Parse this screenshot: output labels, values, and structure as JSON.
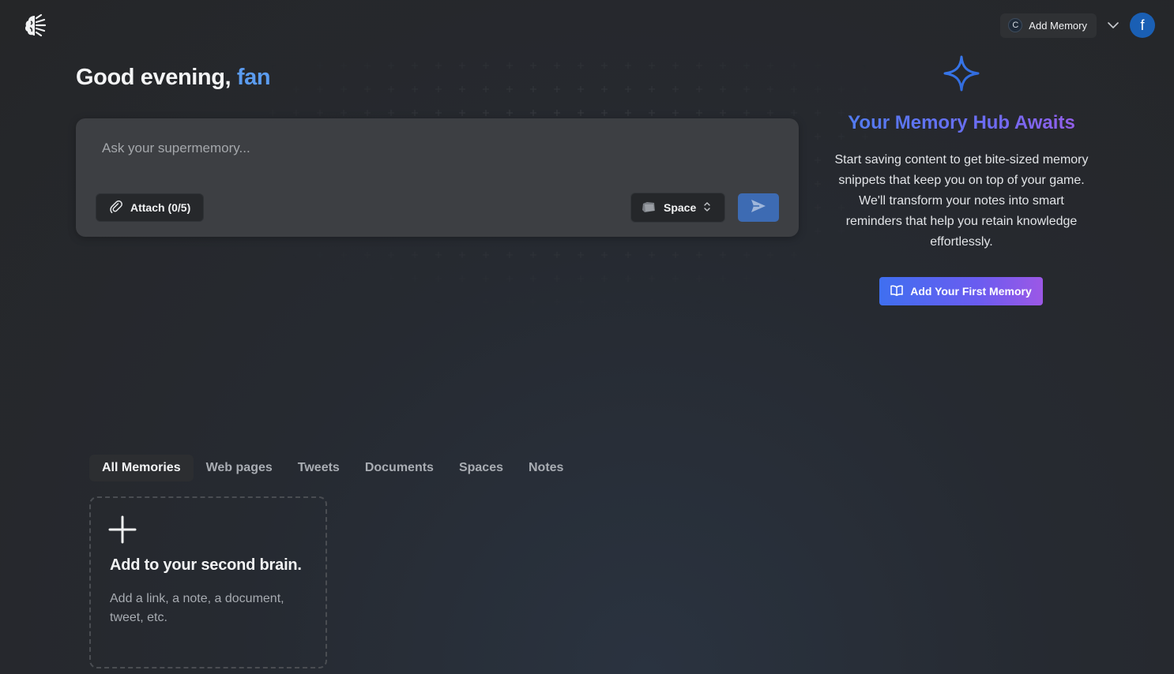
{
  "header": {
    "logo_icon": "brain-logo-icon",
    "add_memory_badge": "C",
    "add_memory_label": "Add Memory",
    "menu_icon": "chevron-down-icon",
    "avatar_initial": "f",
    "avatar_color": "#1a5fb4"
  },
  "greeting": {
    "prefix": "Good evening,",
    "name": "fan"
  },
  "ask": {
    "placeholder": "Ask your supermemory...",
    "value": "",
    "attach_label": "Attach (0/5)",
    "space_label": "Space",
    "send_icon": "send-icon"
  },
  "hub": {
    "icon": "sparkle-icon",
    "title": "Your Memory Hub Awaits",
    "description": "Start saving content to get bite-sized memory snippets that keep you on top of your game. We'll transform your notes into smart reminders that help you retain knowledge effortlessly.",
    "button_label": "Add Your First Memory",
    "accent_start": "#3f6ff0",
    "accent_end": "#9c58e6"
  },
  "tabs": [
    {
      "label": "All Memories",
      "active": true
    },
    {
      "label": "Web pages",
      "active": false
    },
    {
      "label": "Tweets",
      "active": false
    },
    {
      "label": "Documents",
      "active": false
    },
    {
      "label": "Spaces",
      "active": false
    },
    {
      "label": "Notes",
      "active": false
    }
  ],
  "add_card": {
    "title": "Add to your second brain.",
    "description": "Add a link, a note, a document, tweet, etc."
  }
}
